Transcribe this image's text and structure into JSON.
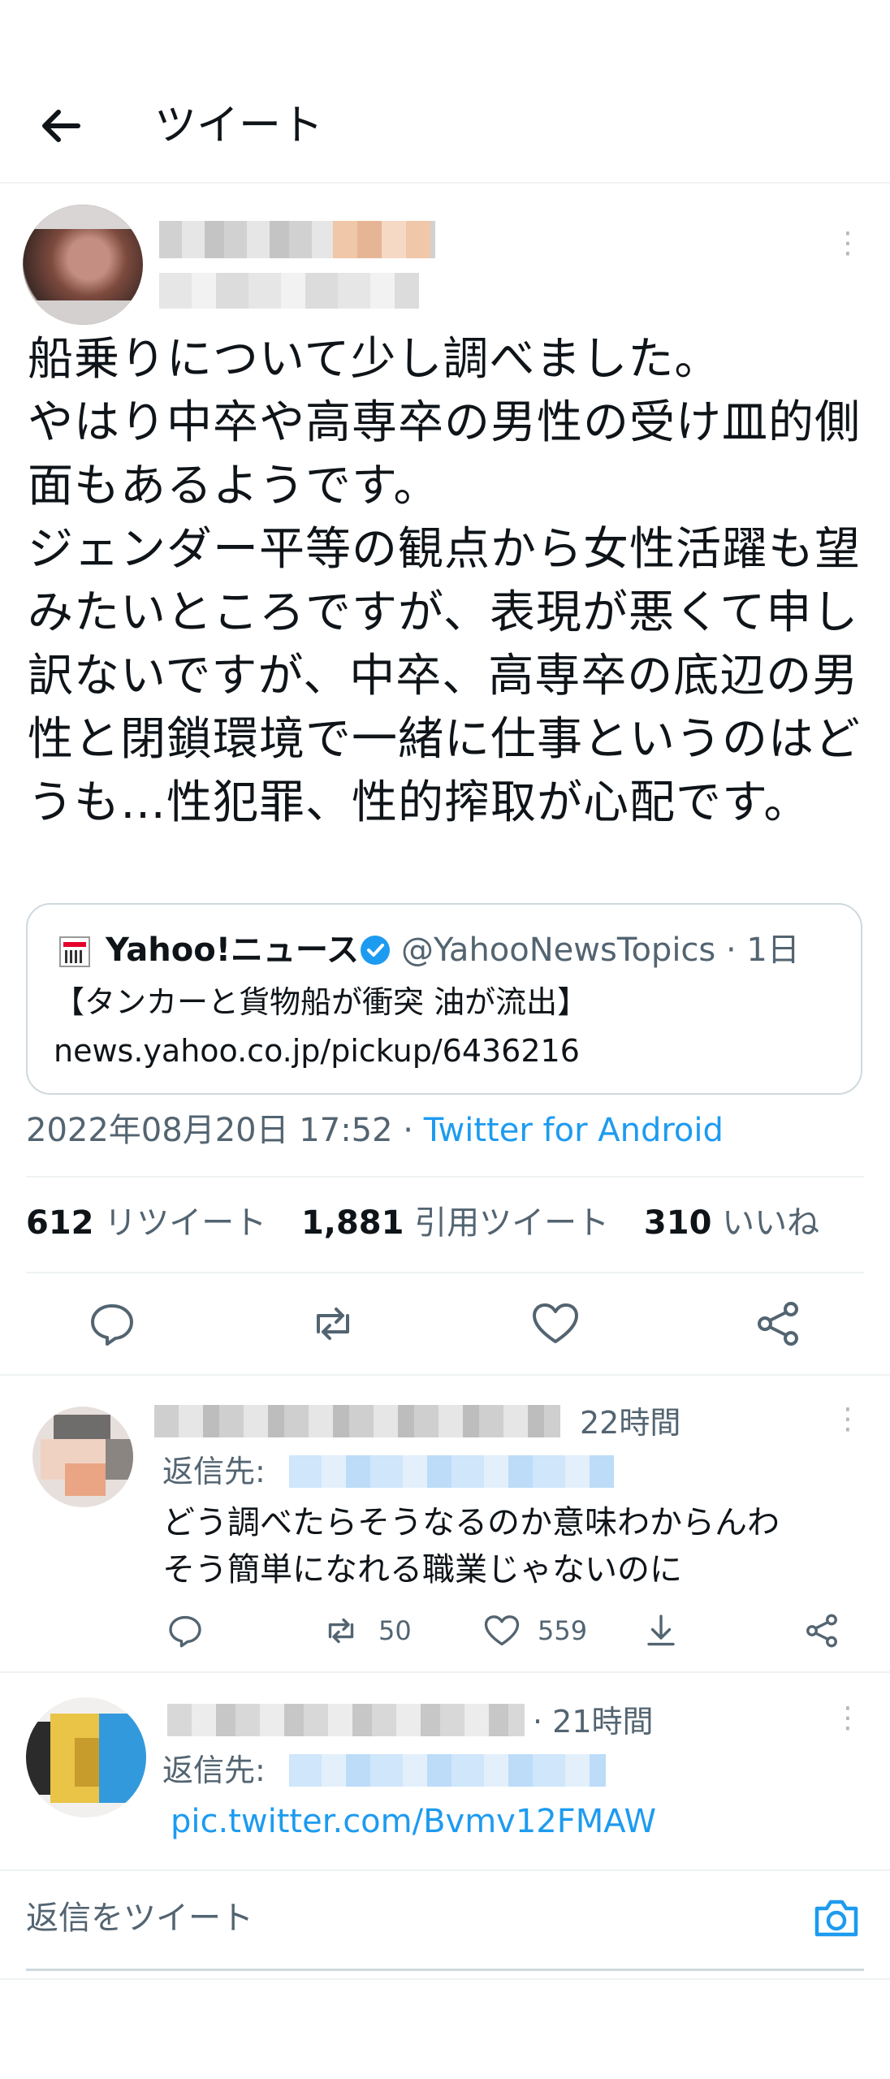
{
  "header": {
    "title": "ツイート"
  },
  "tweet": {
    "text": "船乗りについて少し調べました。\nやはり中卒や高専卒の男性の受け皿的側面もあるようです。\nジェンダー平等の観点から女性活躍も望みたいところですが、表現が悪くて申し訳ないですが、中卒、高専卒の底辺の男性と閉鎖環境で一緒に仕事というのはどうも…性犯罪、性的搾取が心配です。",
    "quote": {
      "name": "Yahoo!ニュース",
      "handle": "@YahooNewsTopics · 1日",
      "headline": "【タンカーと貨物船が衝突 油が流出】",
      "url": "news.yahoo.co.jp/pickup/6436216"
    },
    "timestamp": "2022年08月20日 17:52 · ",
    "via": "Twitter for Android",
    "stats": {
      "retweets": "612",
      "retweets_label": "リツイート",
      "quotes": "1,881",
      "quotes_label": "引用ツイート",
      "likes": "310",
      "likes_label": "いいね"
    }
  },
  "replies": [
    {
      "time": "22時間",
      "to_label": "返信先:",
      "text": "どう調べたらそうなるのか意味わからんわ\nそう簡単になれる職業じゃないのに",
      "retweets": "50",
      "likes": "559"
    },
    {
      "time": "· 21時間",
      "to_label": "返信先:",
      "link": "pic.twitter.com/Bvmv12FMAW"
    }
  ],
  "reply_bar": {
    "placeholder": "返信をツイート"
  },
  "colors": {
    "accent": "#1d9bf0",
    "text": "#0f1419",
    "secondary": "#536471"
  }
}
